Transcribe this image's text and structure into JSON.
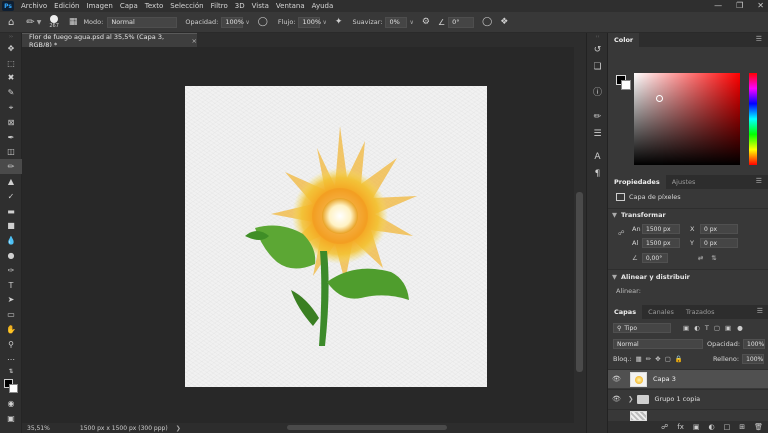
{
  "app": {
    "logo": "Ps"
  },
  "menu": [
    "Archivo",
    "Edición",
    "Imagen",
    "Capa",
    "Texto",
    "Selección",
    "Filtro",
    "3D",
    "Vista",
    "Ventana",
    "Ayuda"
  ],
  "options": {
    "brush_size": "267",
    "mode_label": "Modo:",
    "mode_value": "Normal",
    "opacity_label": "Opacidad:",
    "opacity_value": "100%",
    "flow_label": "Flujo:",
    "flow_value": "100%",
    "smooth_label": "Suavizar:",
    "smooth_value": "0%",
    "angle_value": "0°"
  },
  "document": {
    "tab_title": "Flor de fuego agua.psd al 35,5% (Capa 3, RGB/8) *",
    "close_glyph": "×"
  },
  "status": {
    "zoom": "35,51%",
    "info": "1500 px x 1500 px (300 ppp)"
  },
  "color_panel": {
    "tab": "Color"
  },
  "properties_panel": {
    "tabs": [
      "Propiedades",
      "Ajustes"
    ],
    "layer_kind": "Capa de píxeles",
    "transform_title": "Transformar",
    "an_label": "An",
    "an_value": "1500 px",
    "x_label": "X",
    "x_value": "0 px",
    "al_label": "Al",
    "al_value": "1500 px",
    "y_label": "Y",
    "y_value": "0 px",
    "angle_value": "0,00°",
    "align_title": "Alinear y distribuir",
    "align_label": "Alinear:"
  },
  "layers_panel": {
    "tabs": [
      "Capas",
      "Canales",
      "Trazados"
    ],
    "filter_value": "Tipo",
    "blend_value": "Normal",
    "opacity_label": "Opacidad:",
    "opacity_value": "100%",
    "lock_label": "Bloq.:",
    "fill_label": "Relleno:",
    "fill_value": "100%",
    "layers": [
      {
        "name": "Capa 3"
      },
      {
        "name": "Grupo 1 copia"
      }
    ]
  },
  "accent_colors": {
    "selected_layer": "#505050",
    "panel_bg": "#383838"
  }
}
